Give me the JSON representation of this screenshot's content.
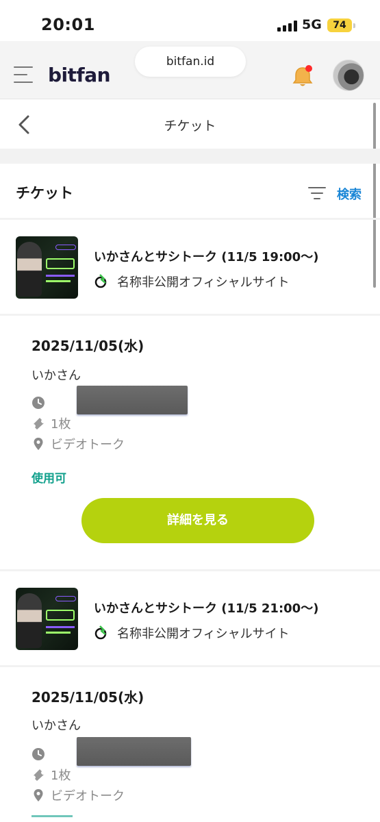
{
  "status_bar": {
    "time": "20:01",
    "network": "5G",
    "battery": "74"
  },
  "browser": {
    "url": "bitfan.id"
  },
  "app": {
    "logo": "bitfan",
    "menu_icon": "hamburger-icon",
    "notification_icon": "bell-icon",
    "notification_badge_color": "#ff2a2a"
  },
  "page": {
    "title": "チケット",
    "back_icon": "chevron-left-icon"
  },
  "section": {
    "title": "チケット",
    "filter_icon": "filter-icon",
    "search_label": "検索"
  },
  "events": [
    {
      "title": "いかさんとサシトーク (11/5 19:00〜)",
      "organizer": "名称非公開オフィシャルサイト",
      "ticket": {
        "date": "2025/11/05(水)",
        "performer": "いかさん",
        "quantity": "1枚",
        "type": "ビデオトーク",
        "status": "使用可",
        "button_label": "詳細を見る"
      }
    },
    {
      "title": "いかさんとサシトーク (11/5 21:00〜)",
      "organizer": "名称非公開オフィシャルサイト",
      "ticket": {
        "date": "2025/11/05(水)",
        "performer": "いかさん",
        "quantity": "1枚",
        "type": "ビデオトーク"
      }
    }
  ],
  "colors": {
    "accent_button": "#b5d20e",
    "status_green": "#11a08c",
    "link_blue": "#1a86d6",
    "battery_yellow": "#f7d23d"
  }
}
